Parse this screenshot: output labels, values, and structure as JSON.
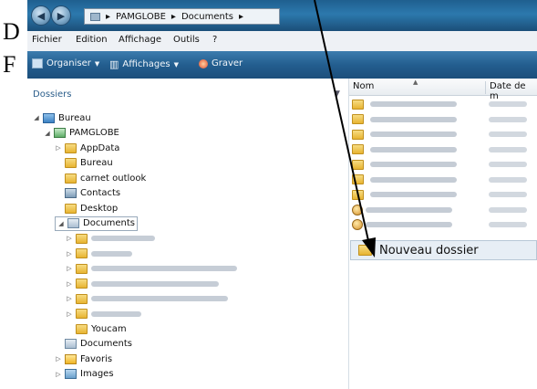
{
  "doc_letters": {
    "d": "D",
    "f": "F"
  },
  "address": {
    "crumbs": [
      "PAMGLOBE",
      "Documents"
    ],
    "sep": "▸"
  },
  "menu": [
    "Fichier",
    "Edition",
    "Affichage",
    "Outils",
    "?"
  ],
  "toolbar": {
    "organize": "Organiser",
    "views": "Affichages",
    "burn": "Graver"
  },
  "left": {
    "header": "Dossiers",
    "tree": [
      {
        "label": "Bureau",
        "indent": 0,
        "twisty": "open",
        "icon": "blue"
      },
      {
        "label": "PAMGLOBE",
        "indent": 1,
        "twisty": "open",
        "icon": "green"
      },
      {
        "label": "AppData",
        "indent": 2,
        "twisty": "closed",
        "icon": "folder"
      },
      {
        "label": "Bureau",
        "indent": 2,
        "twisty": "none",
        "icon": "folder"
      },
      {
        "label": "carnet outlook",
        "indent": 2,
        "twisty": "none",
        "icon": "folder"
      },
      {
        "label": "Contacts",
        "indent": 2,
        "twisty": "none",
        "icon": "contact"
      },
      {
        "label": "Desktop",
        "indent": 2,
        "twisty": "none",
        "icon": "folder"
      },
      {
        "label": "Documents",
        "indent": 2,
        "twisty": "open",
        "icon": "doc",
        "selected": true
      },
      {
        "label": "",
        "indent": 3,
        "twisty": "closed",
        "icon": "folder",
        "blur": 70
      },
      {
        "label": "",
        "indent": 3,
        "twisty": "closed",
        "icon": "folder",
        "blur": 45
      },
      {
        "label": "",
        "indent": 3,
        "twisty": "closed",
        "icon": "folder",
        "blur": 160
      },
      {
        "label": "",
        "indent": 3,
        "twisty": "closed",
        "icon": "folder",
        "blur": 140
      },
      {
        "label": "",
        "indent": 3,
        "twisty": "closed",
        "icon": "folder",
        "blur": 150
      },
      {
        "label": "",
        "indent": 3,
        "twisty": "closed",
        "icon": "folder",
        "blur": 55
      },
      {
        "label": "Youcam",
        "indent": 3,
        "twisty": "none",
        "icon": "folder"
      },
      {
        "label": "Documents",
        "indent": 2,
        "twisty": "none",
        "icon": "doc"
      },
      {
        "label": "Favoris",
        "indent": 2,
        "twisty": "closed",
        "icon": "star"
      },
      {
        "label": "Images",
        "indent": 2,
        "twisty": "closed",
        "icon": "img"
      }
    ]
  },
  "right": {
    "col_name": "Nom",
    "col_date": "Date de m",
    "rows": [
      {
        "icon": "folder"
      },
      {
        "icon": "folder"
      },
      {
        "icon": "folder"
      },
      {
        "icon": "folder"
      },
      {
        "icon": "folder"
      },
      {
        "icon": "folder"
      },
      {
        "icon": "folder"
      },
      {
        "icon": "exe"
      },
      {
        "icon": "exe"
      }
    ],
    "new_folder": "Nouveau dossier"
  }
}
